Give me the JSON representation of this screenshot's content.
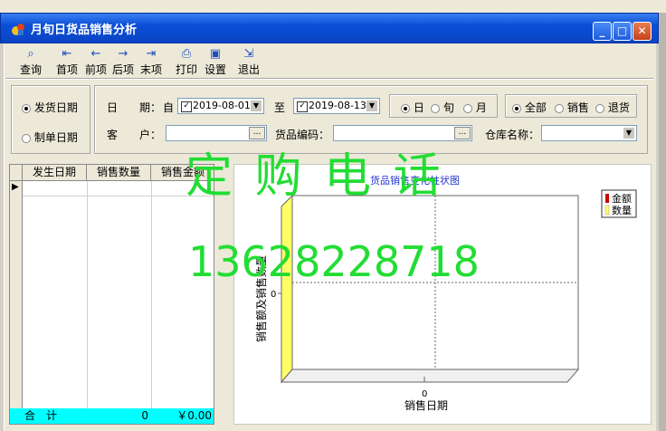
{
  "window": {
    "title": "月旬日货品销售分析",
    "minimize": "_",
    "maximize": "□",
    "close": "✕"
  },
  "toolbar": [
    {
      "label": "查询",
      "icon": "binoculars-icon",
      "glyph": "⌕"
    },
    {
      "label": "首项",
      "icon": "first-arrow-icon",
      "glyph": "⇤"
    },
    {
      "label": "前项",
      "icon": "prev-arrow-icon",
      "glyph": "←"
    },
    {
      "label": "后项",
      "icon": "next-arrow-icon",
      "glyph": "→"
    },
    {
      "label": "末项",
      "icon": "last-arrow-icon",
      "glyph": "⇥"
    },
    {
      "label": "打印",
      "icon": "printer-icon",
      "glyph": "⎙"
    },
    {
      "label": "设置",
      "icon": "settings-icon",
      "glyph": "▣"
    },
    {
      "label": "退出",
      "icon": "exit-door-icon",
      "glyph": "⇲"
    }
  ],
  "date_type": {
    "options": [
      "发货日期",
      "制单日期"
    ],
    "selected": "发货日期"
  },
  "filters": {
    "period_label": "日　　期：",
    "from_label": "自",
    "from_date": "2019-08-01",
    "to_label": "至",
    "to_date": "2019-08-13",
    "customer_label": "客　　户：",
    "customer_value": "",
    "product_code_label": "货品编码：",
    "product_code_value": "",
    "warehouse_label": "仓库名称：",
    "warehouse_value": "",
    "dots": "..."
  },
  "granularity": {
    "options": [
      "日",
      "旬",
      "月"
    ],
    "selected": "日"
  },
  "scope": {
    "options": [
      "全部",
      "销售",
      "退货"
    ],
    "selected": "全部"
  },
  "grid": {
    "columns": [
      "发生日期",
      "销售数量",
      "销售金额"
    ],
    "row_marker": "▶",
    "totals_label": "合　计",
    "totals_qty": "0",
    "totals_amount": "￥0.00"
  },
  "chart_data": {
    "type": "bar",
    "title": "货品销售变化柱状图",
    "xlabel": "销售日期",
    "ylabel": "销售额及销售数量",
    "categories": [],
    "series": [
      {
        "name": "金额",
        "values": [],
        "color": "#cc0000"
      },
      {
        "name": "数量",
        "values": [],
        "color": "#ffff66"
      }
    ],
    "y_tick": "0",
    "x_tick": "0",
    "grid": true,
    "legend": "top-right"
  },
  "watermark": {
    "line1": "定 购 电 话",
    "line2": "13628228718"
  },
  "colors": {
    "titlebar": "#0a4fd6",
    "totals_row": "#00ffff",
    "watermark": "#22dd33"
  }
}
